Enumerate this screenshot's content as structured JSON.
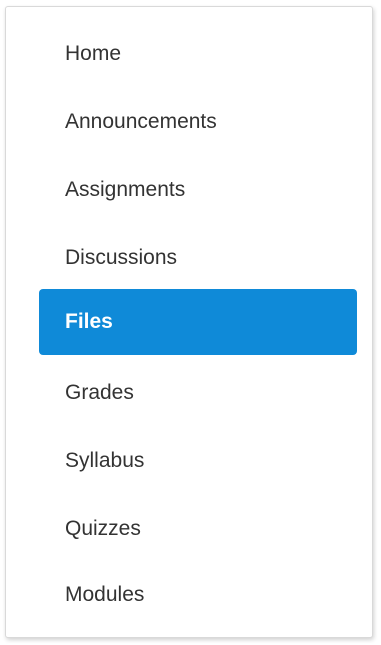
{
  "nav": {
    "items": [
      {
        "label": "Home",
        "active": false
      },
      {
        "label": "Announcements",
        "active": false
      },
      {
        "label": "Assignments",
        "active": false
      },
      {
        "label": "Discussions",
        "active": false
      },
      {
        "label": "Files",
        "active": true
      },
      {
        "label": "Grades",
        "active": false
      },
      {
        "label": "Syllabus",
        "active": false
      },
      {
        "label": "Quizzes",
        "active": false
      },
      {
        "label": "Modules",
        "active": false
      }
    ]
  },
  "colors": {
    "active_bg": "#0f8ad8",
    "active_text": "#ffffff",
    "text": "#333333"
  }
}
